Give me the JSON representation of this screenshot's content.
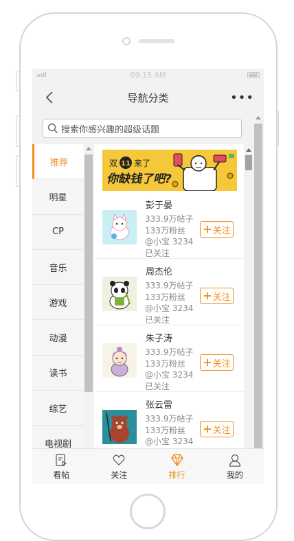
{
  "status_bar": {
    "time": "09:15 AM"
  },
  "nav": {
    "title": "导航分类",
    "more": "•••"
  },
  "search": {
    "placeholder": "搜索你感兴趣的超级话题"
  },
  "categories": [
    {
      "label": "推荐",
      "active": true
    },
    {
      "label": "明星"
    },
    {
      "label": "CP"
    },
    {
      "label": "音乐"
    },
    {
      "label": "游戏"
    },
    {
      "label": "动漫"
    },
    {
      "label": "读书"
    },
    {
      "label": "综艺"
    },
    {
      "label": "电视剧"
    }
  ],
  "banner": {
    "text_double": "双",
    "text_eleven": "11",
    "text_came": "来了",
    "text_main": "你缺钱了吧?"
  },
  "users": [
    {
      "name": "彭于晏",
      "posts": "333.9万帖子",
      "fans": "133万粉丝",
      "followed": "@小宝 3234已关注",
      "follow_label": "关注",
      "avatar": "cat-avatar"
    },
    {
      "name": "周杰伦",
      "posts": "333.9万帖子",
      "fans": "133万粉丝",
      "followed": "@小宝 3234已关注",
      "follow_label": "关注",
      "avatar": "panda-avatar"
    },
    {
      "name": "朱子涛",
      "posts": "333.9万帖子",
      "fans": "133万粉丝",
      "followed": "@小宝 3234已关注",
      "follow_label": "关注",
      "avatar": "girl-avatar"
    },
    {
      "name": "张云雷",
      "posts": "333.9万帖子",
      "fans": "133万粉丝",
      "followed": "@小宝 3234已关注",
      "follow_label": "关注",
      "avatar": "bear-avatar"
    }
  ],
  "tabs": [
    {
      "label": "看帖",
      "icon": "post-icon"
    },
    {
      "label": "关注",
      "icon": "heart-icon"
    },
    {
      "label": "排行",
      "icon": "diamond-icon",
      "active": true
    },
    {
      "label": "我的",
      "icon": "user-icon"
    }
  ],
  "colors": {
    "accent": "#f08c1e",
    "banner": "#f5c73a"
  }
}
